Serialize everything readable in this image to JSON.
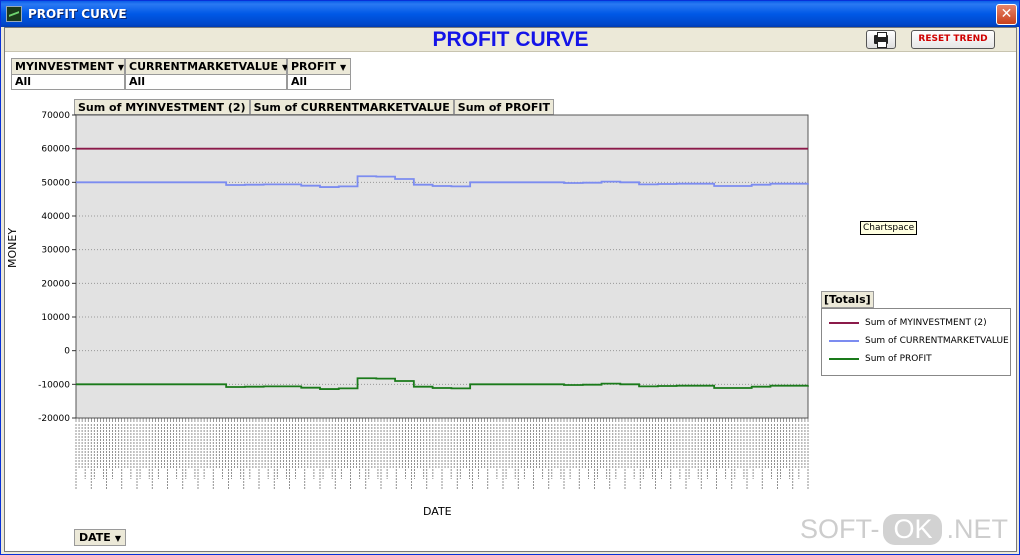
{
  "window": {
    "title": "PROFIT CURVE",
    "close_glyph": "✕"
  },
  "header": {
    "title": "PROFIT CURVE",
    "reset_label": "RESET TREND"
  },
  "filters": [
    {
      "label": "MYINVESTMENT",
      "value": "All"
    },
    {
      "label": "CURRENTMARKETVALUE",
      "value": "All"
    },
    {
      "label": "PROFIT",
      "value": "All"
    }
  ],
  "series_tabs": [
    "Sum of MYINVESTMENT (2)",
    "Sum of CURRENTMARKETVALUE",
    "Sum of PROFIT"
  ],
  "tooltip": "Chartspace",
  "legend": {
    "title": "[Totals]",
    "items": [
      {
        "label": "Sum of MYINVESTMENT (2)",
        "color": "#8b1a4a"
      },
      {
        "label": "Sum of CURRENTMARKETVALUE",
        "color": "#7c8cf0"
      },
      {
        "label": "Sum of PROFIT",
        "color": "#1a7a1a"
      }
    ]
  },
  "date_button": "DATE",
  "watermark": {
    "left": "SOFT-",
    "ok": "OK",
    "right": ".NET"
  },
  "chart_data": {
    "type": "line",
    "xlabel": "DATE",
    "ylabel": "MONEY",
    "ylim": [
      -20000,
      70000
    ],
    "yticks": [
      70000,
      60000,
      50000,
      40000,
      30000,
      20000,
      10000,
      0,
      -10000,
      -20000
    ],
    "grid": true,
    "legend_position": "right",
    "series": [
      {
        "name": "Sum of MYINVESTMENT (2)",
        "color": "#8b1a4a",
        "values": [
          60000,
          60000,
          60000,
          60000,
          60000,
          60000,
          60000,
          60000,
          60000,
          60000,
          60000,
          60000,
          60000,
          60000,
          60000,
          60000,
          60000,
          60000,
          60000,
          60000,
          60000,
          60000,
          60000,
          60000,
          60000,
          60000,
          60000,
          60000,
          60000,
          60000,
          60000,
          60000,
          60000,
          60000,
          60000,
          60000,
          60000,
          60000,
          60000,
          60000
        ]
      },
      {
        "name": "Sum of CURRENTMARKETVALUE",
        "color": "#7c8cf0",
        "values": [
          50000,
          50000,
          50000,
          50000,
          50000,
          50000,
          50000,
          50000,
          49200,
          49300,
          49400,
          49400,
          49000,
          48600,
          48800,
          51800,
          51700,
          51000,
          49300,
          48900,
          48800,
          50000,
          50000,
          50000,
          50000,
          50000,
          49800,
          49900,
          50200,
          50000,
          49400,
          49500,
          49600,
          49600,
          48900,
          48900,
          49300,
          49600,
          49600,
          49700
        ]
      },
      {
        "name": "Sum of PROFIT",
        "color": "#1a7a1a",
        "values": [
          -10000,
          -10000,
          -10000,
          -10000,
          -10000,
          -10000,
          -10000,
          -10000,
          -10800,
          -10700,
          -10600,
          -10600,
          -11000,
          -11400,
          -11200,
          -8200,
          -8300,
          -9000,
          -10700,
          -11100,
          -11200,
          -10000,
          -10000,
          -10000,
          -10000,
          -10000,
          -10200,
          -10100,
          -9800,
          -10000,
          -10600,
          -10500,
          -10400,
          -10400,
          -11100,
          -11100,
          -10700,
          -10400,
          -10400,
          -10300
        ]
      }
    ]
  }
}
